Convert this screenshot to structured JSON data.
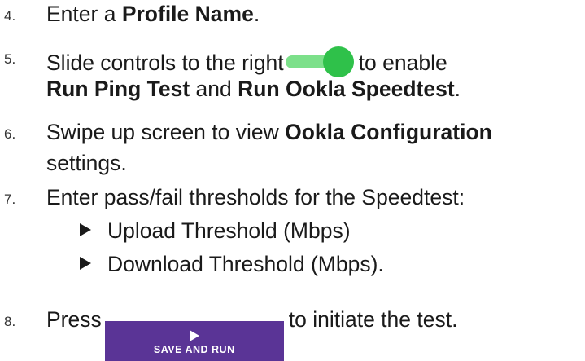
{
  "steps": [
    {
      "num": "4.",
      "before": "Enter a ",
      "bold": "Profile Name",
      "after": "."
    },
    {
      "num": "5.",
      "line1_before": "Slide controls to the right",
      "line1_after": "to enable",
      "b1": "Run Ping Test",
      "mid": " and ",
      "b2": "Run Ookla Speedtest",
      "end": "."
    },
    {
      "num": "6.",
      "before": "Swipe up screen to view ",
      "bold": "Ookla Configuration",
      "line2": "settings."
    },
    {
      "num": "7.",
      "text": "Enter pass/fail thresholds for the Speedtest:",
      "bullets": [
        "Upload Threshold (Mbps)",
        "Download Threshold (Mbps)."
      ]
    },
    {
      "num": "8.",
      "before": "Press",
      "after": "to initiate the test."
    }
  ],
  "toggle": {
    "state": "on",
    "track_color": "#7ce08a",
    "knob_color": "#2fc14a"
  },
  "save_button": {
    "label": "SAVE AND RUN",
    "icon": "play-icon",
    "color": "#5a3496"
  }
}
